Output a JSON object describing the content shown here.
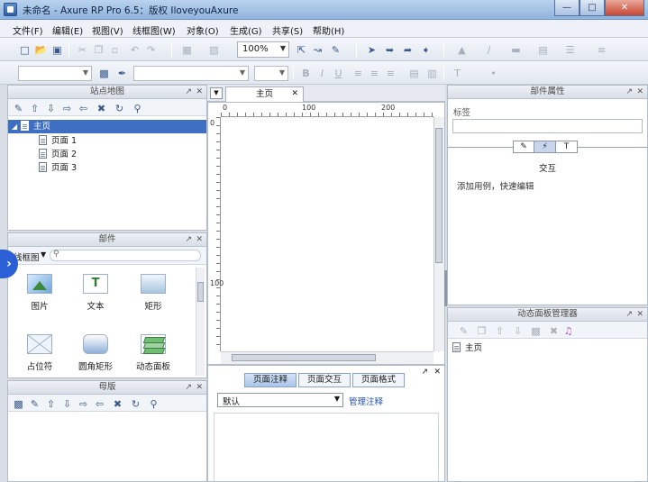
{
  "window": {
    "title": "未命名 - Axure RP Pro 6.5：版权 IloveyouAxure"
  },
  "menu": [
    "文件(F)",
    "编辑(E)",
    "视图(V)",
    "线框图(W)",
    "对象(O)",
    "生成(G)",
    "共享(S)",
    "帮助(H)"
  ],
  "toolbar": {
    "zoom": "100%"
  },
  "sitemap": {
    "title": "站点地图",
    "root": "主页",
    "pages": [
      "页面 1",
      "页面 2",
      "页面 3"
    ]
  },
  "widgets_panel": {
    "title": "部件",
    "library": "线框图",
    "items": [
      "图片",
      "文本",
      "矩形",
      "占位符",
      "圆角矩形",
      "动态面板"
    ]
  },
  "masters_panel": {
    "title": "母版"
  },
  "editor": {
    "tab": "主页",
    "ruler_marks": [
      "0",
      "100",
      "200"
    ],
    "vruler_marks": [
      "0",
      "100"
    ]
  },
  "notes": {
    "tabs": [
      "页面注释",
      "页面交互",
      "页面格式"
    ],
    "select_value": "默认",
    "link": "管理注释"
  },
  "props_panel": {
    "title": "部件属性",
    "label_field": "标签",
    "tabs": [
      "交互"
    ],
    "hint": "添加用例，快速编辑"
  },
  "dynamic_panel_manager": {
    "title": "动态面板管理器",
    "root": "主页"
  },
  "colors": {
    "selection": "#3e6fc2",
    "accent": "#2b5fd6"
  }
}
